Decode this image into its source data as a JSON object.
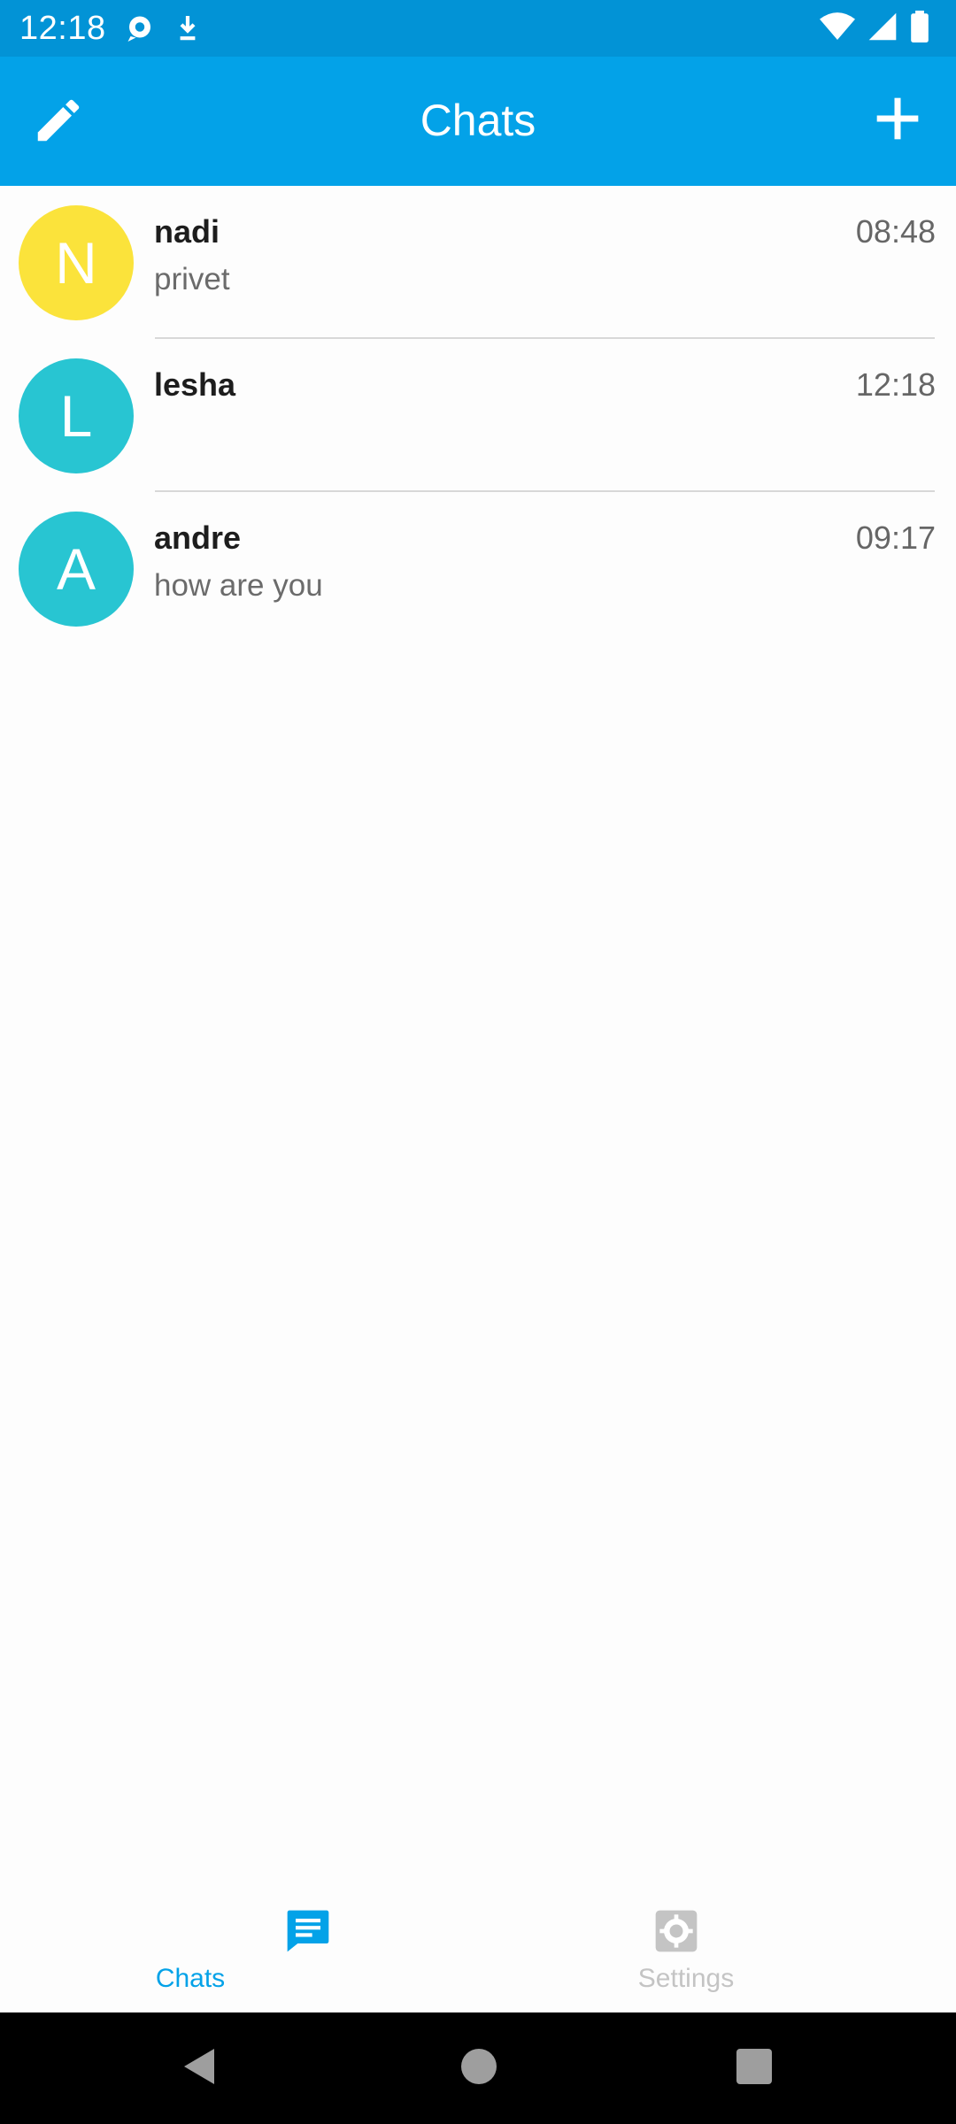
{
  "status_bar": {
    "time": "12:18",
    "left_icons": [
      "chat-bubble-notification-icon",
      "download-notification-icon"
    ],
    "right_icons": [
      "wifi-icon",
      "cellular-signal-icon",
      "battery-icon"
    ]
  },
  "app_bar": {
    "title": "Chats",
    "left_action": "edit-pencil-icon",
    "right_action": "add-plus-icon",
    "background": "#03a2e8"
  },
  "chats": [
    {
      "initial": "N",
      "name": "nadi",
      "time": "08:48",
      "preview": "privet",
      "avatar_color": "#fbe33b"
    },
    {
      "initial": "L",
      "name": "lesha",
      "time": "12:18",
      "preview": "",
      "avatar_color": "#28c5d2"
    },
    {
      "initial": "A",
      "name": "andre",
      "time": "09:17",
      "preview": "how are you",
      "avatar_color": "#28c5d2"
    }
  ],
  "bottom_nav": {
    "tabs": [
      {
        "label": "Chats",
        "icon": "chat-icon",
        "active": true,
        "color": "#03a2e8"
      },
      {
        "label": "Settings",
        "icon": "settings-icon",
        "active": false,
        "color": "#c4c4c4"
      }
    ]
  },
  "system_nav": {
    "buttons": [
      "back-icon",
      "home-icon",
      "recents-icon"
    ]
  }
}
